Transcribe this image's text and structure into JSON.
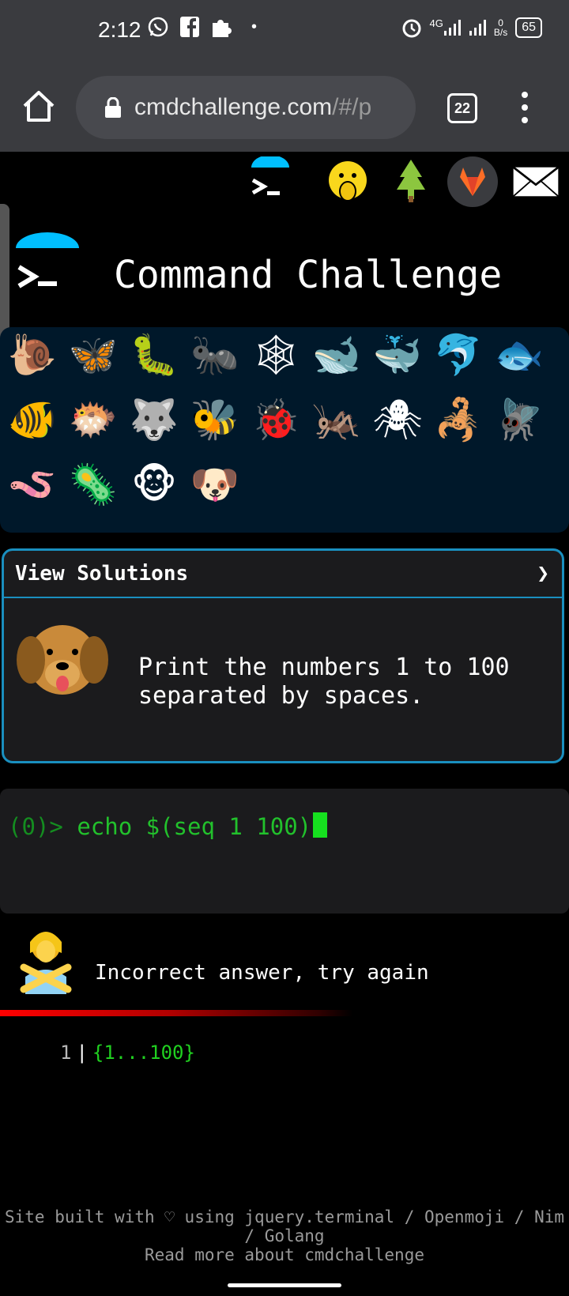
{
  "status_bar": {
    "time": "2:12",
    "network": "4G",
    "data_speed": "0\nB/s",
    "battery": "65"
  },
  "browser": {
    "url_main": "cmdchallenge.com",
    "url_rest": "/#/p",
    "tab_count": "22"
  },
  "page": {
    "title": "Command Challenge",
    "nav_icons": [
      "terminal-icon",
      "shush-face-icon",
      "tree-icon",
      "gitlab-icon",
      "mail-icon"
    ],
    "emojis": [
      {
        "name": "snail-icon",
        "glyph": "🐌"
      },
      {
        "name": "butterfly-icon",
        "glyph": "🦋"
      },
      {
        "name": "caterpillar-icon",
        "glyph": "🐛"
      },
      {
        "name": "ant-icon",
        "glyph": "🐜"
      },
      {
        "name": "spider-web-icon",
        "glyph": "🕸"
      },
      {
        "name": "whale-icon",
        "glyph": "🐋"
      },
      {
        "name": "spouting-whale-icon",
        "glyph": "🐳"
      },
      {
        "name": "dolphin-icon",
        "glyph": "🐬"
      },
      {
        "name": "fish-icon",
        "glyph": "🐟"
      },
      {
        "name": "tropical-fish-icon",
        "glyph": "🐠"
      },
      {
        "name": "blowfish-icon",
        "glyph": "🐡"
      },
      {
        "name": "wolf-icon",
        "glyph": "🐺"
      },
      {
        "name": "bee-icon",
        "glyph": "🐝"
      },
      {
        "name": "ladybug-icon",
        "glyph": "🐞"
      },
      {
        "name": "cricket-icon",
        "glyph": "🦗"
      },
      {
        "name": "spider-icon",
        "glyph": "🕷"
      },
      {
        "name": "scorpion-icon",
        "glyph": "🦂"
      },
      {
        "name": "fly-icon",
        "glyph": "🪰"
      },
      {
        "name": "worm-icon",
        "glyph": "🪱"
      },
      {
        "name": "microbe-icon",
        "glyph": "🦠"
      },
      {
        "name": "monkey-icon",
        "glyph": "🐵"
      },
      {
        "name": "dog-icon",
        "glyph": "🐶"
      }
    ],
    "solutions": {
      "label": "View Solutions",
      "chevron": "❯",
      "task": "Print the numbers 1 to 100\nseparated by spaces."
    },
    "terminal": {
      "prompt_open": "(",
      "prompt_num": "0",
      "prompt_close": ")> ",
      "command": "echo $(seq 1 100)"
    },
    "result": {
      "message": "Incorrect answer, try again",
      "line_number": "1",
      "separator": "|",
      "output": "{1...100}"
    },
    "footer": {
      "line1": "Site built with ♡ using jquery.terminal / Openmoji / Nim",
      "line2": "/ Golang",
      "line3": "Read more about cmdchallenge"
    }
  }
}
